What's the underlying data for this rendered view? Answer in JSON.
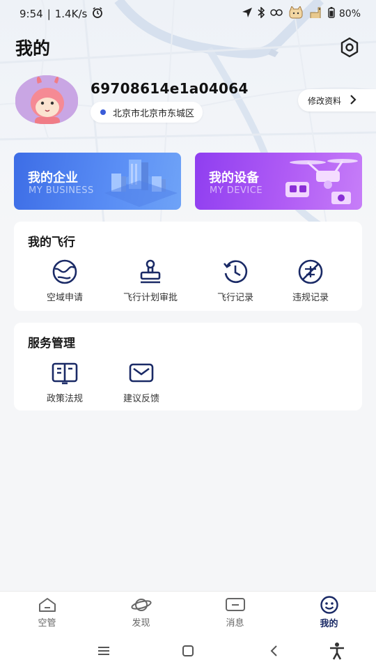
{
  "status_bar": {
    "time": "9:54",
    "speed": "1.4K/s",
    "battery": "80%"
  },
  "header": {
    "title": "我的",
    "settings_icon": "hexagon-gear-icon"
  },
  "profile": {
    "user_id": "69708614e1a04064",
    "location": "北京市北京市东城区",
    "edit_label": "修改资料"
  },
  "banners": [
    {
      "title": "我的企业",
      "subtitle": "MY BUSINESS",
      "color": "#3d6de6"
    },
    {
      "title": "我的设备",
      "subtitle": "MY DEVICE",
      "color": "#9a47f2"
    }
  ],
  "flight_section": {
    "title": "我的飞行",
    "items": [
      {
        "label": "空域申请",
        "icon": "globe-icon"
      },
      {
        "label": "飞行计划审批",
        "icon": "stamp-icon"
      },
      {
        "label": "飞行记录",
        "icon": "history-clock-icon"
      },
      {
        "label": "违规记录",
        "icon": "no-drone-icon"
      }
    ]
  },
  "service_section": {
    "title": "服务管理",
    "items": [
      {
        "label": "政策法规",
        "icon": "open-book-icon"
      },
      {
        "label": "建议反馈",
        "icon": "mail-icon"
      }
    ]
  },
  "tabs": [
    {
      "label": "空管",
      "icon": "home-icon",
      "active": false
    },
    {
      "label": "发现",
      "icon": "planet-icon",
      "active": false
    },
    {
      "label": "消息",
      "icon": "message-icon",
      "active": false
    },
    {
      "label": "我的",
      "icon": "smile-icon",
      "active": true
    }
  ],
  "accent_color": "#1a2a66"
}
